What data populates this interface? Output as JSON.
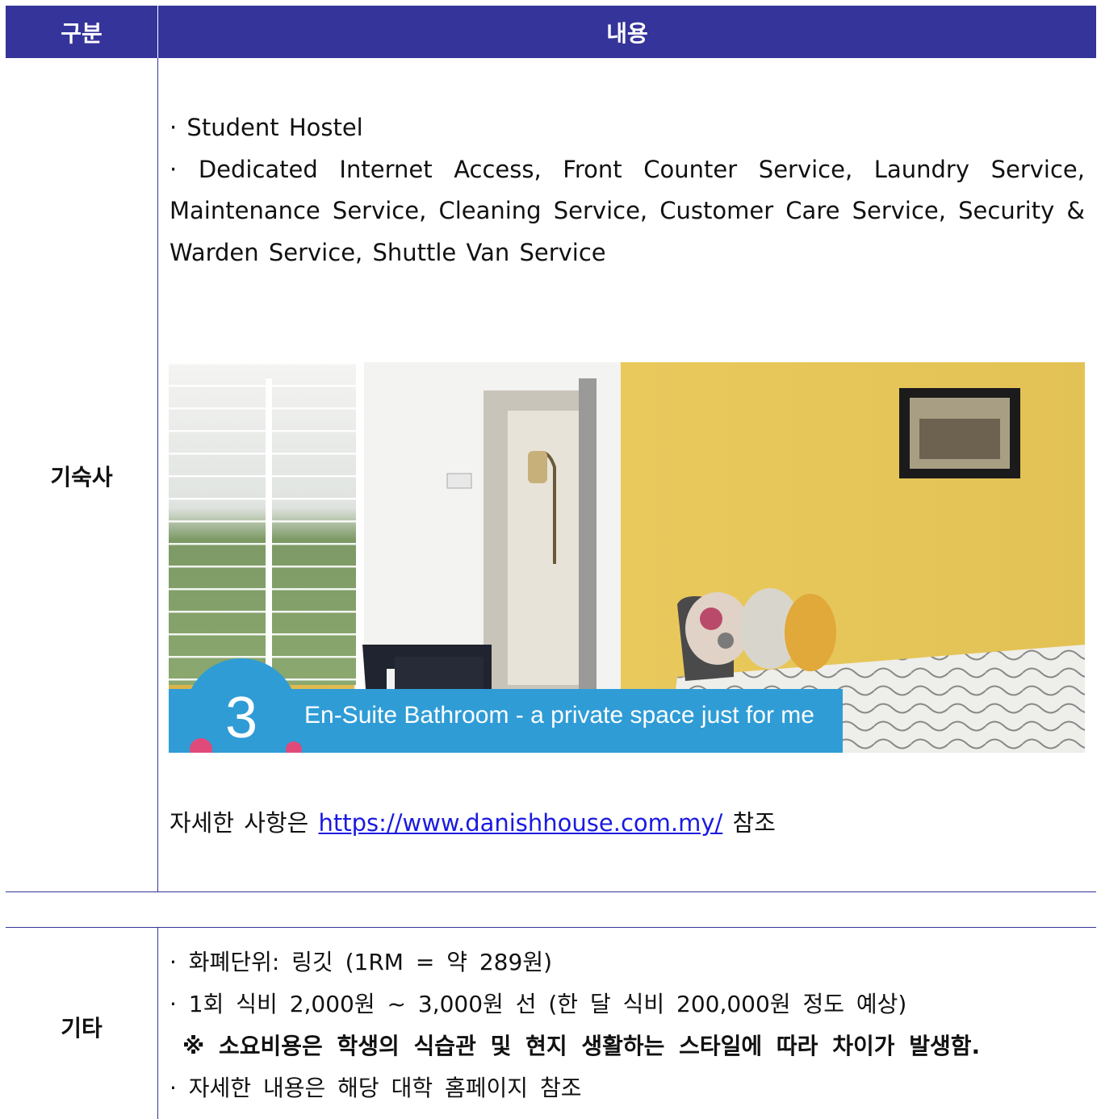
{
  "header": {
    "col1": "구분",
    "col2": "내용"
  },
  "dorm": {
    "label": "기숙사",
    "lines": [
      "· Student Hostel",
      "· Dedicated Internet Access, Front Counter Service, Laundry Service, Maintenance Service, Cleaning Service, Customer Care Service, Security & Warden Service, Shuttle Van Service"
    ],
    "photo": {
      "badge_number": "3",
      "caption": "En-Suite Bathroom - a private space just for me"
    },
    "more_prefix": "자세한 사항은",
    "more_link": "https://www.danishhouse.com.my/",
    "more_suffix": "참조"
  },
  "etc": {
    "label": "기타",
    "line1": "· 화폐단위: 링깃 (1RM = 약 289원)",
    "line2": "· 1회 식비 2,000원 ~ 3,000원 선 (한 달 식비 200,000원 정도 예상)",
    "note": "※ 소요비용은 학생의 식습관 및 현지 생활하는 스타일에 따라 차이가 발생함.",
    "line3": "· 자세한 내용은 해당 대학 홈페이지 참조"
  }
}
